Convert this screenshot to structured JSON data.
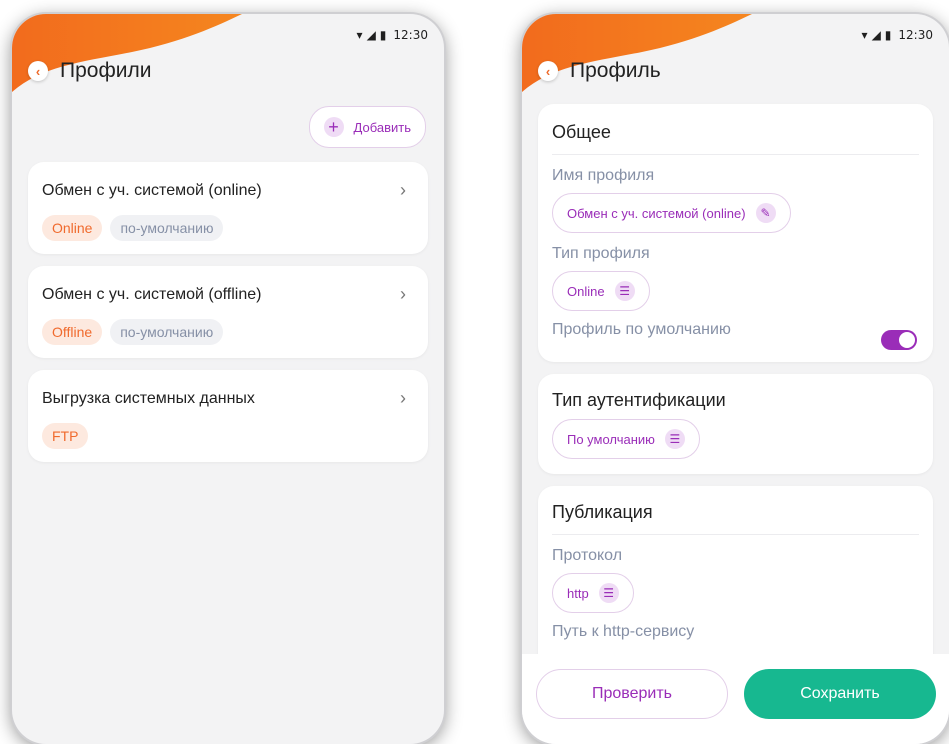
{
  "status": {
    "time": "12:30"
  },
  "left": {
    "title": "Профили",
    "add_label": "Добавить",
    "profiles": [
      {
        "name": "Обмен с уч. системой (online)",
        "tags": [
          {
            "text": "Online",
            "style": "orange"
          },
          {
            "text": "по-умолчанию",
            "style": "gray"
          }
        ]
      },
      {
        "name": "Обмен с уч. системой (offline)",
        "tags": [
          {
            "text": "Offline",
            "style": "orange"
          },
          {
            "text": "по-умолчанию",
            "style": "gray"
          }
        ]
      },
      {
        "name": "Выгрузка системных данных",
        "tags": [
          {
            "text": "FTP",
            "style": "orange"
          }
        ]
      }
    ]
  },
  "right": {
    "title": "Профиль",
    "general": {
      "title": "Общее",
      "name_label": "Имя профиля",
      "name_value": "Обмен с уч. системой (online)",
      "type_label": "Тип профиля",
      "type_value": "Online",
      "default_label": "Профиль по умолчанию",
      "default_on": true
    },
    "auth": {
      "title": "Тип аутентификации",
      "value": "По умолчанию"
    },
    "publication": {
      "title": "Публикация",
      "protocol_label": "Протокол",
      "protocol_value": "http",
      "path_label": "Путь к http-сервису"
    },
    "check_label": "Проверить",
    "save_label": "Сохранить"
  },
  "colors": {
    "accent": "#9a2db8",
    "brand_orange": "#f06a2d",
    "save_green": "#17b890"
  }
}
